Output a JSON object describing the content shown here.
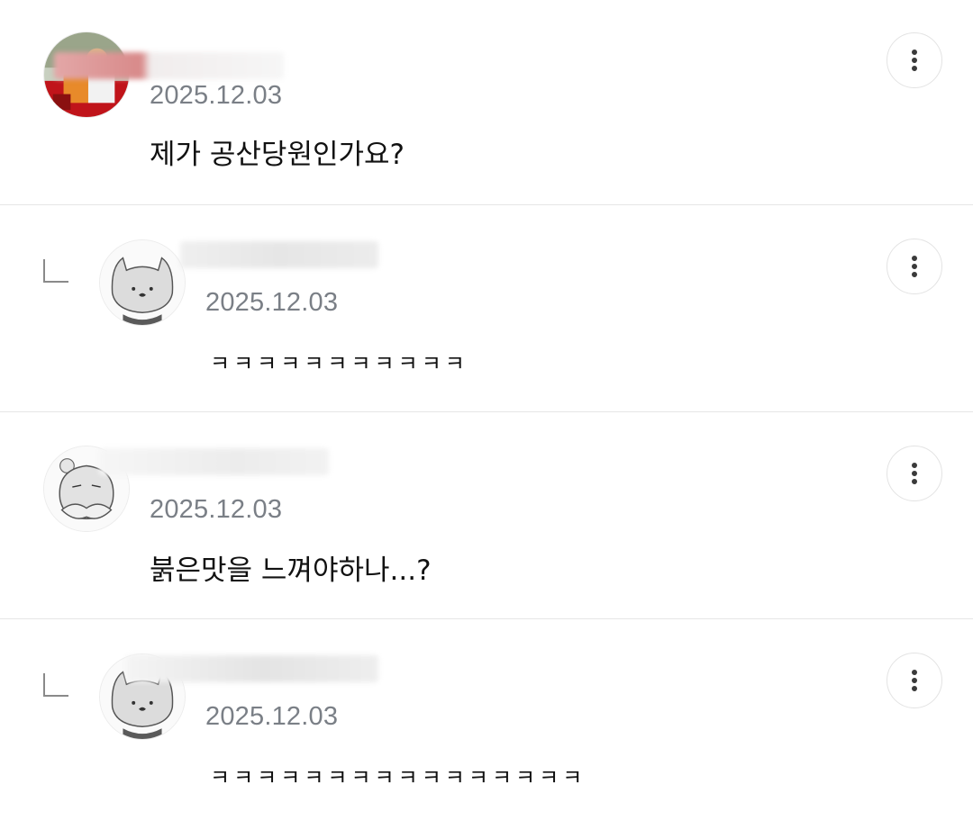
{
  "comments": [
    {
      "date": "2025.12.03",
      "text": "제가 공산당원인가요?",
      "is_reply": false
    },
    {
      "date": "2025.12.03",
      "text": "ㅋㅋㅋㅋㅋㅋㅋㅋㅋㅋㅋ",
      "is_reply": true
    },
    {
      "date": "2025.12.03",
      "text": "붉은맛을 느껴야하나...?",
      "is_reply": false
    },
    {
      "date": "2025.12.03",
      "text": "ㅋㅋㅋㅋㅋㅋㅋㅋㅋㅋㅋㅋㅋㅋㅋㅋ",
      "is_reply": true
    }
  ],
  "icons": {
    "more": "more-vertical-icon",
    "reply": "reply-corner-icon"
  },
  "colors": {
    "date": "#7a7f86",
    "divider": "#e6e6e6",
    "text": "#111111"
  }
}
